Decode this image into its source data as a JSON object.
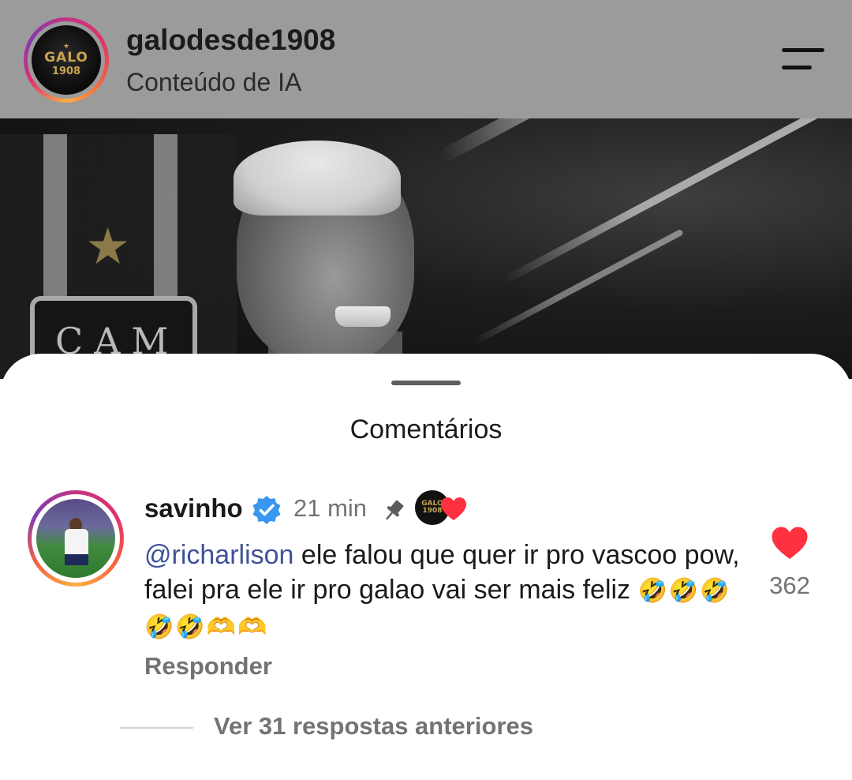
{
  "header": {
    "username": "galodesde1908",
    "subtitle": "Conteúdo de IA",
    "avatar_text_top": "GALO",
    "avatar_text_bottom": "1908",
    "menu_icon": "menu-icon"
  },
  "post_image": {
    "crest_text": "CAM"
  },
  "comments": {
    "title": "Comentários",
    "items": [
      {
        "username": "savinho",
        "verified": true,
        "time": "21 min",
        "pinned": true,
        "liked_by_creator": true,
        "mention": "@richarlison",
        "text": " ele falou que quer ir pro vascoo pow, falei pra ele ir pro galao vai ser mais feliz ",
        "emojis": "🤣🤣🤣🤣🤣🫶🫶",
        "likes": "362",
        "reply_label": "Responder"
      }
    ],
    "view_replies": "Ver 31 respostas anteriores"
  },
  "colors": {
    "header_bg": "#9b9b9b",
    "mention": "#3e5298",
    "verified": "#3897f0",
    "heart": "#ff3040",
    "muted_text": "#737373"
  }
}
